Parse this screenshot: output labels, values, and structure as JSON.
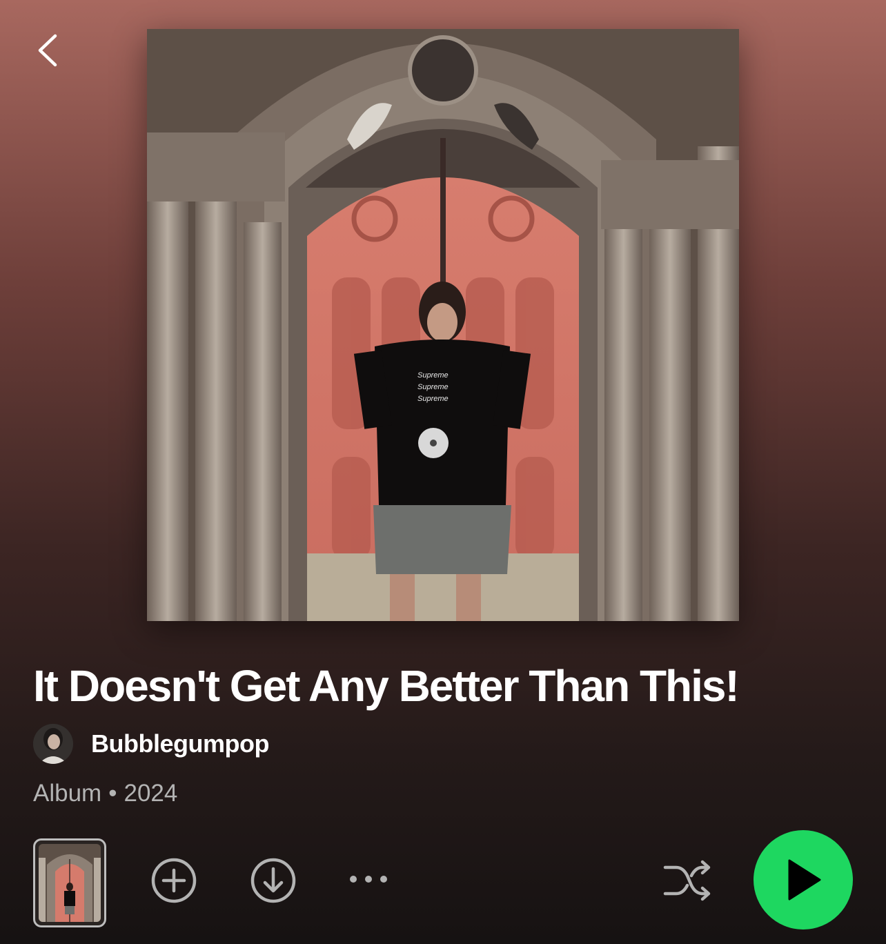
{
  "album": {
    "title": "It Doesn't Get Any Better Than This!",
    "artist": "Bubblegumpop",
    "type": "Album",
    "separator": "•",
    "year": "2024"
  },
  "icons": {
    "back": "chevron-left-icon",
    "add": "plus-circle-icon",
    "download": "download-circle-icon",
    "more": "more-horizontal-icon",
    "shuffle": "shuffle-icon",
    "play": "play-icon"
  },
  "colors": {
    "accent": "#1ed760",
    "secondary_text": "#b3b3b3",
    "header_gradient_top": "#a8685f"
  }
}
